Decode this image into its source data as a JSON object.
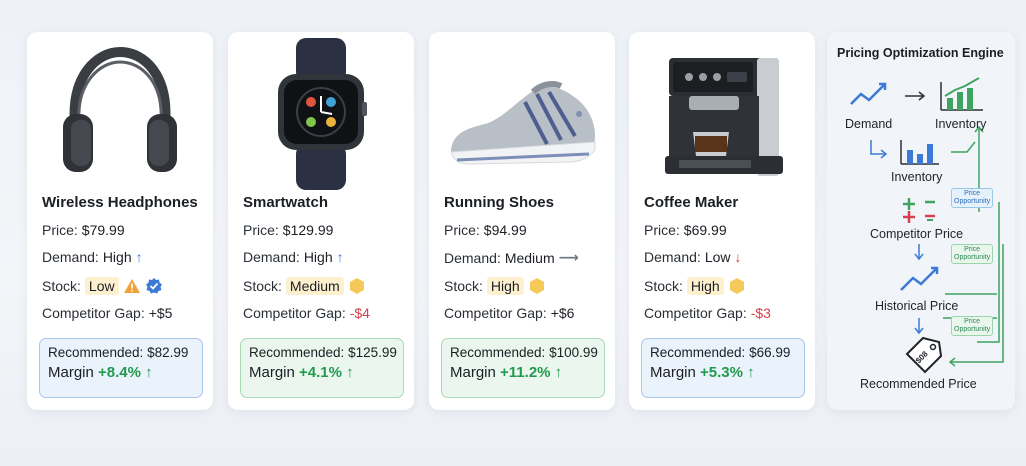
{
  "products": [
    {
      "name": "Wireless Headphones",
      "price_label": "Price:",
      "price": "$79.99",
      "demand_label": "Demand:",
      "demand": "High",
      "demand_icon": "arrow-up-icon",
      "stock_label": "Stock:",
      "stock": "Low",
      "stock_icons": [
        "warning-icon",
        "verified-badge-icon"
      ],
      "gap_label": "Competitor Gap:",
      "gap": "+$5",
      "recommended_label": "Recommended:",
      "recommended": "$82.99",
      "margin_label": "Margin",
      "margin": "+8.4%",
      "box_color": "#eaf2fc"
    },
    {
      "name": "Smartwatch",
      "price_label": "Price:",
      "price": "$129.99",
      "demand_label": "Demand:",
      "demand": "High",
      "demand_icon": "arrow-up-icon",
      "stock_label": "Stock:",
      "stock": "Medium",
      "stock_icons": [
        "hexagon-icon"
      ],
      "gap_label": "Competitor Gap:",
      "gap": "-$4",
      "recommended_label": "Recommended:",
      "recommended": "$125.99",
      "margin_label": "Margin",
      "margin": "+4.1%",
      "box_color": "#eaf6ee"
    },
    {
      "name": "Running Shoes",
      "price_label": "Price:",
      "price": "$94.99",
      "demand_label": "Demand:",
      "demand": "Medium",
      "demand_icon": "arrow-right-icon",
      "stock_label": "Stock:",
      "stock": "High",
      "stock_icons": [
        "hexagon-icon"
      ],
      "gap_label": "Competitor Gap:",
      "gap": "+$6",
      "recommended_label": "Recommended:",
      "recommended": "$100.99",
      "margin_label": "Margin",
      "margin": "+11.2%",
      "box_color": "#eaf6ee"
    },
    {
      "name": "Coffee Maker",
      "price_label": "Price:",
      "price": "$69.99",
      "demand_label": "Demand:",
      "demand": "Low",
      "demand_icon": "arrow-down-icon",
      "stock_label": "Stock:",
      "stock": "High",
      "stock_icons": [
        "hexagon-icon"
      ],
      "gap_label": "Competitor Gap:",
      "gap": "-$3",
      "recommended_label": "Recommended:",
      "recommended": "$66.99",
      "margin_label": "Margin",
      "margin": "+5.3%",
      "box_color": "#eaf2fc"
    }
  ],
  "engine": {
    "title": "Pricing Optimization Engine",
    "demand": "Demand",
    "inventory_top": "Inventory",
    "inventory": "Inventory",
    "competitor_price": "Competitor Price",
    "historical_price": "Historical Price",
    "recommended_price": "Recommended Price",
    "opportunity_1_line1": "Price",
    "opportunity_1_line2": "Opportunity",
    "opportunity_2_line1": "Price",
    "opportunity_2_line2": "Opportunity",
    "opportunity_3_line1": "Price",
    "opportunity_3_line2": "Opportunity",
    "tag_text": "$08"
  },
  "colors": {
    "accent_blue": "#3c7ad6",
    "positive_green": "#219a4d",
    "negative_red": "#d6404a",
    "stock_chip": "#fdf0cf"
  }
}
